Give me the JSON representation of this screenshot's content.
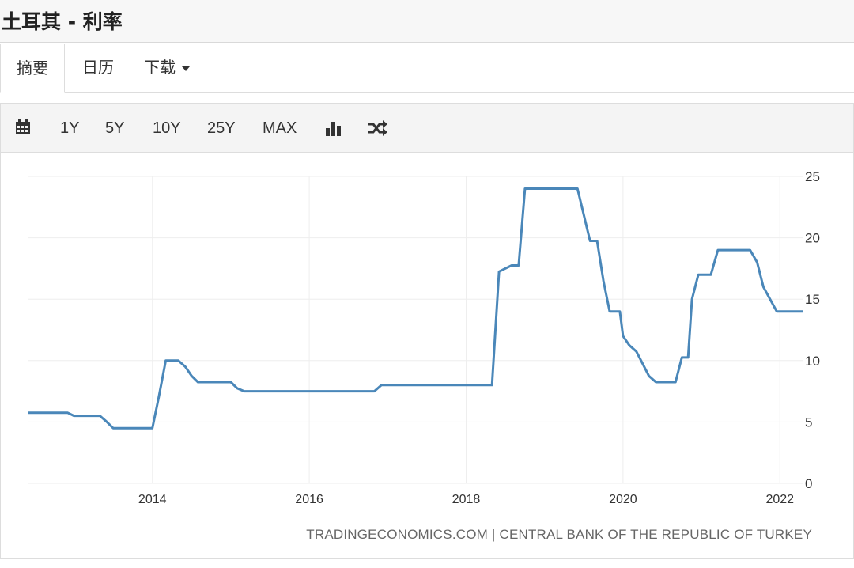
{
  "header": {
    "title": "土耳其 - 利率"
  },
  "tabs": [
    {
      "label": "摘要",
      "active": true
    },
    {
      "label": "日历",
      "active": false
    },
    {
      "label": "下载",
      "active": false,
      "has_dropdown": true
    }
  ],
  "toolbar": {
    "calendar_icon": "calendar-icon",
    "ranges": [
      "1Y",
      "5Y",
      "10Y",
      "25Y",
      "MAX"
    ],
    "bar_chart_icon": "bar-chart-icon",
    "compare_icon": "shuffle-icon"
  },
  "source_text": "TRADINGECONOMICS.COM | CENTRAL BANK OF THE REPUBLIC OF TURKEY",
  "colors": {
    "line": "#4a87b9",
    "grid": "#eeeeee",
    "accent": "#333333"
  },
  "chart_data": {
    "type": "line",
    "title": "",
    "xlabel": "",
    "ylabel": "",
    "xlim": [
      2012.42,
      2022.3
    ],
    "ylim": [
      0,
      25
    ],
    "x_ticks": [
      2014,
      2016,
      2018,
      2020,
      2022
    ],
    "y_ticks": [
      0,
      5,
      10,
      15,
      20,
      25
    ],
    "y_axis_position": "right",
    "grid": true,
    "series": [
      {
        "x": [
          2012.42,
          2012.92,
          2013.0,
          2013.33,
          2013.42,
          2013.5,
          2014.0,
          2014.08,
          2014.17,
          2014.33,
          2014.42,
          2014.5,
          2014.58,
          2015.0,
          2015.08,
          2015.17,
          2016.83,
          2016.92,
          2018.33,
          2018.42,
          2018.58,
          2018.67,
          2018.75,
          2019.42,
          2019.58,
          2019.67,
          2019.75,
          2019.83,
          2019.92,
          2019.96,
          2020.0,
          2020.08,
          2020.17,
          2020.25,
          2020.33,
          2020.42,
          2020.5,
          2020.67,
          2020.75,
          2020.83,
          2020.88,
          2020.96,
          2021.12,
          2021.21,
          2021.62,
          2021.71,
          2021.79,
          2021.96,
          2022.3
        ],
        "y": [
          5.75,
          5.75,
          5.5,
          5.5,
          5.0,
          4.5,
          4.5,
          7.0,
          10.0,
          10.0,
          9.5,
          8.75,
          8.25,
          8.25,
          7.75,
          7.5,
          7.5,
          8.0,
          8.0,
          17.25,
          17.75,
          17.75,
          24.0,
          24.0,
          19.75,
          19.75,
          16.5,
          14.0,
          14.0,
          14.0,
          12.0,
          11.25,
          10.75,
          9.75,
          8.75,
          8.25,
          8.25,
          8.25,
          10.25,
          10.25,
          15.0,
          17.0,
          17.0,
          19.0,
          19.0,
          18.0,
          16.0,
          14.0,
          14.0
        ]
      }
    ]
  }
}
